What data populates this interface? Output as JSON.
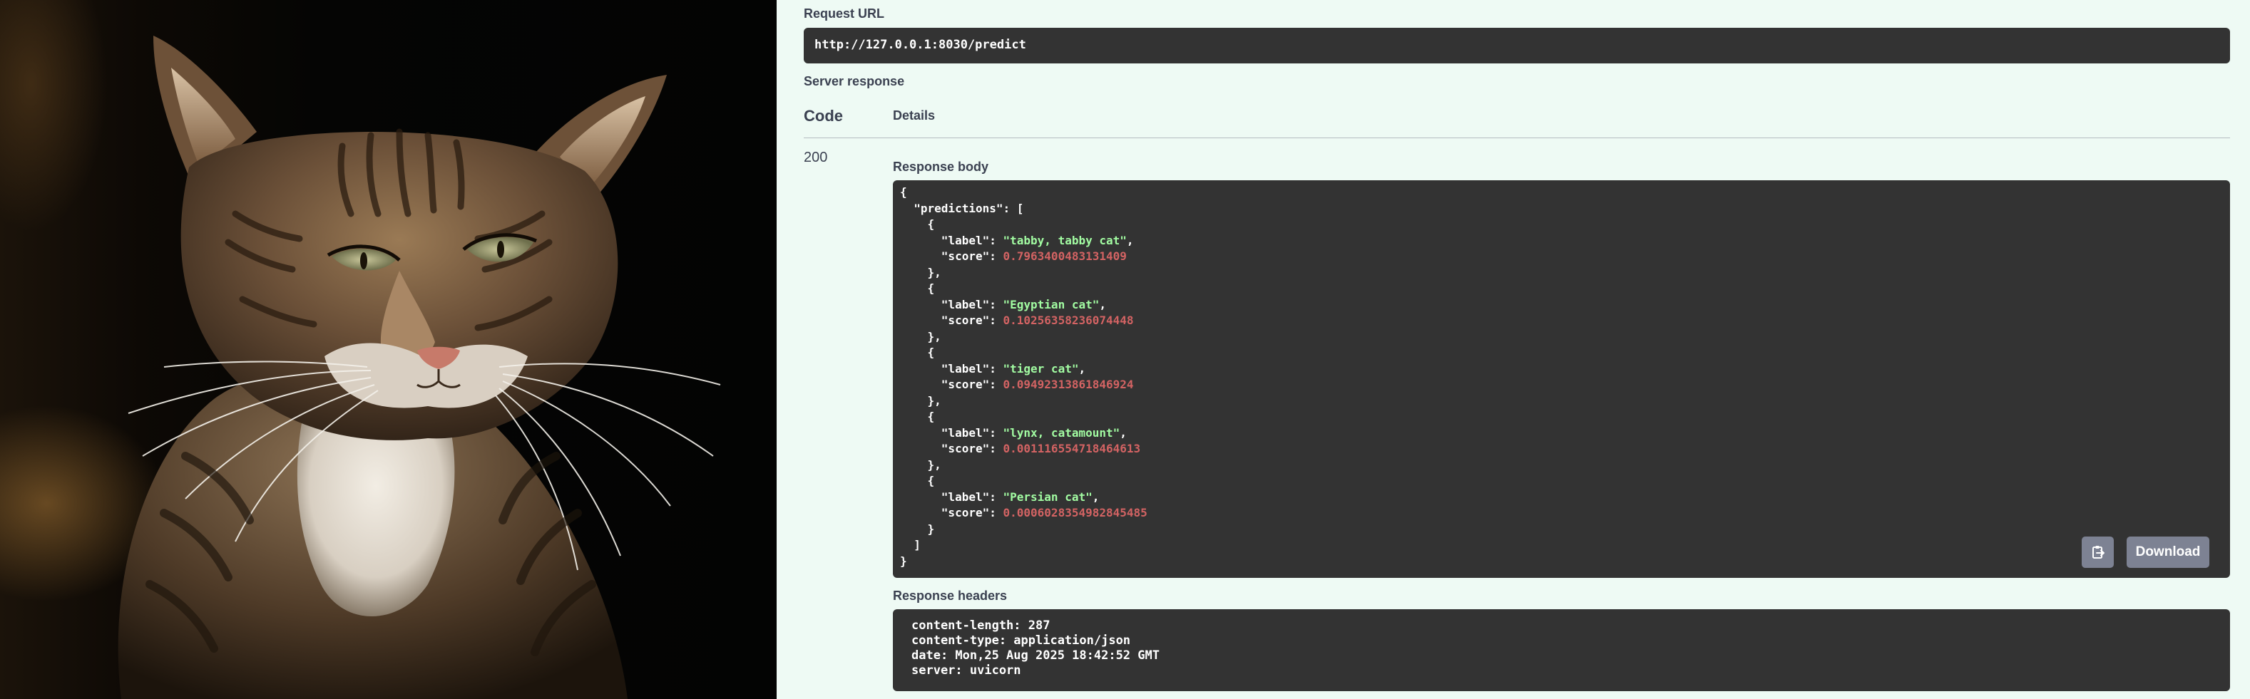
{
  "colors": {
    "panel_background": "#eefaf4",
    "code_background": "#333333",
    "json_string": "#a2fca2",
    "json_number": "#d36363",
    "button_background": "#7d8293"
  },
  "photo": {
    "subject": "tabby cat portrait"
  },
  "response": {
    "request_url_label": "Request URL",
    "request_url": "http://127.0.0.1:8030/predict",
    "server_response_label": "Server response",
    "col_code": "Code",
    "col_details": "Details",
    "status_code": "200",
    "response_body_label": "Response body",
    "body": {
      "key": "predictions",
      "predictions": [
        {
          "label": "tabby, tabby cat",
          "score": "0.7963400483131409"
        },
        {
          "label": "Egyptian cat",
          "score": "0.10256358236074448"
        },
        {
          "label": "tiger cat",
          "score": "0.09492313861846924"
        },
        {
          "label": "lynx, catamount",
          "score": "0.001116554718464613"
        },
        {
          "label": "Persian cat",
          "score": "0.0006028354982845485"
        }
      ]
    },
    "copy_icon": "clipboard-icon",
    "download_label": "Download",
    "response_headers_label": "Response headers",
    "headers": [
      "content-length: 287",
      "content-type: application/json",
      "date: Mon,25 Aug 2025 18:42:52 GMT",
      "server: uvicorn"
    ]
  }
}
